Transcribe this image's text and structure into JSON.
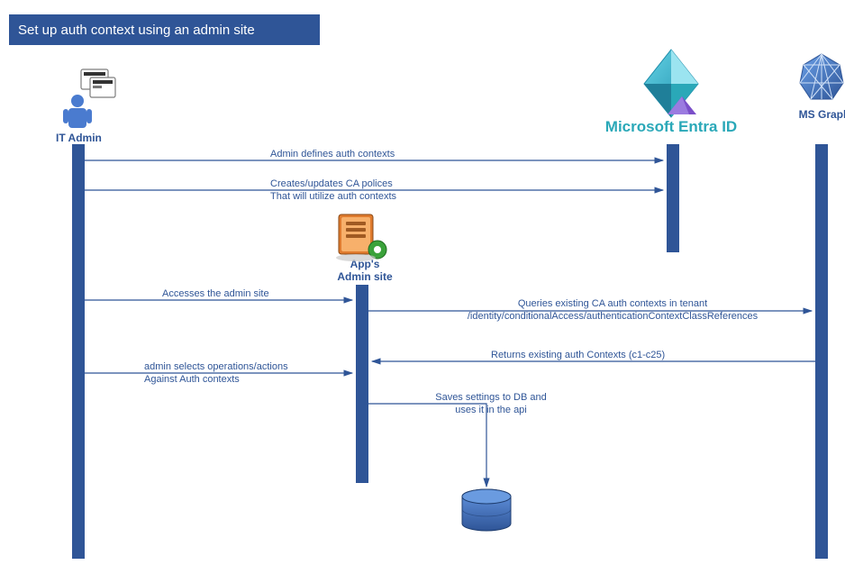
{
  "title": "Set up auth context using an admin site",
  "actors": {
    "it_admin": "IT Admin",
    "admin_site_line1": "App's",
    "admin_site_line2": "Admin site",
    "entra": "Microsoft Entra ID",
    "ms_graph": "MS Graph",
    "database": "Database"
  },
  "messages": {
    "m1": "Admin defines auth contexts",
    "m2_l1": "Creates/updates CA polices",
    "m2_l2": "That will utilize auth contexts",
    "m3": "Accesses the admin site",
    "m4_l1": "Queries existing CA auth contexts in tenant",
    "m4_l2": "/identity/conditionalAccess/authenticationContextClassReferences",
    "m5": "Returns existing auth Contexts (c1-c25)",
    "m6_l1": "admin selects operations/actions",
    "m6_l2": "Against Auth contexts",
    "m7_l1": "Saves settings to DB and",
    "m7_l2": "uses it in the api"
  },
  "colors": {
    "primary": "#2f5597",
    "accent_teal": "#2aa8b8",
    "accent_purple": "#7b4fc9",
    "server_orange": "#e07b2e",
    "server_green": "#3aa23a"
  },
  "chart_data": {
    "type": "sequence-diagram",
    "title": "Set up auth context using an admin site",
    "participants": [
      "IT Admin",
      "App's Admin site",
      "Microsoft Entra ID",
      "MS Graph",
      "Database"
    ],
    "messages": [
      {
        "from": "IT Admin",
        "to": "Microsoft Entra ID",
        "text": "Admin defines auth contexts"
      },
      {
        "from": "IT Admin",
        "to": "Microsoft Entra ID",
        "text": "Creates/updates CA polices That will utilize auth contexts"
      },
      {
        "from": "IT Admin",
        "to": "App's Admin site",
        "text": "Accesses the admin site"
      },
      {
        "from": "App's Admin site",
        "to": "MS Graph",
        "text": "Queries existing CA auth contexts in tenant /identity/conditionalAccess/authenticationContextClassReferences"
      },
      {
        "from": "MS Graph",
        "to": "App's Admin site",
        "text": "Returns existing auth Contexts (c1-c25)"
      },
      {
        "from": "IT Admin",
        "to": "App's Admin site",
        "text": "admin selects operations/actions Against Auth contexts"
      },
      {
        "from": "App's Admin site",
        "to": "Database",
        "text": "Saves settings to DB and uses it in the api"
      }
    ]
  }
}
